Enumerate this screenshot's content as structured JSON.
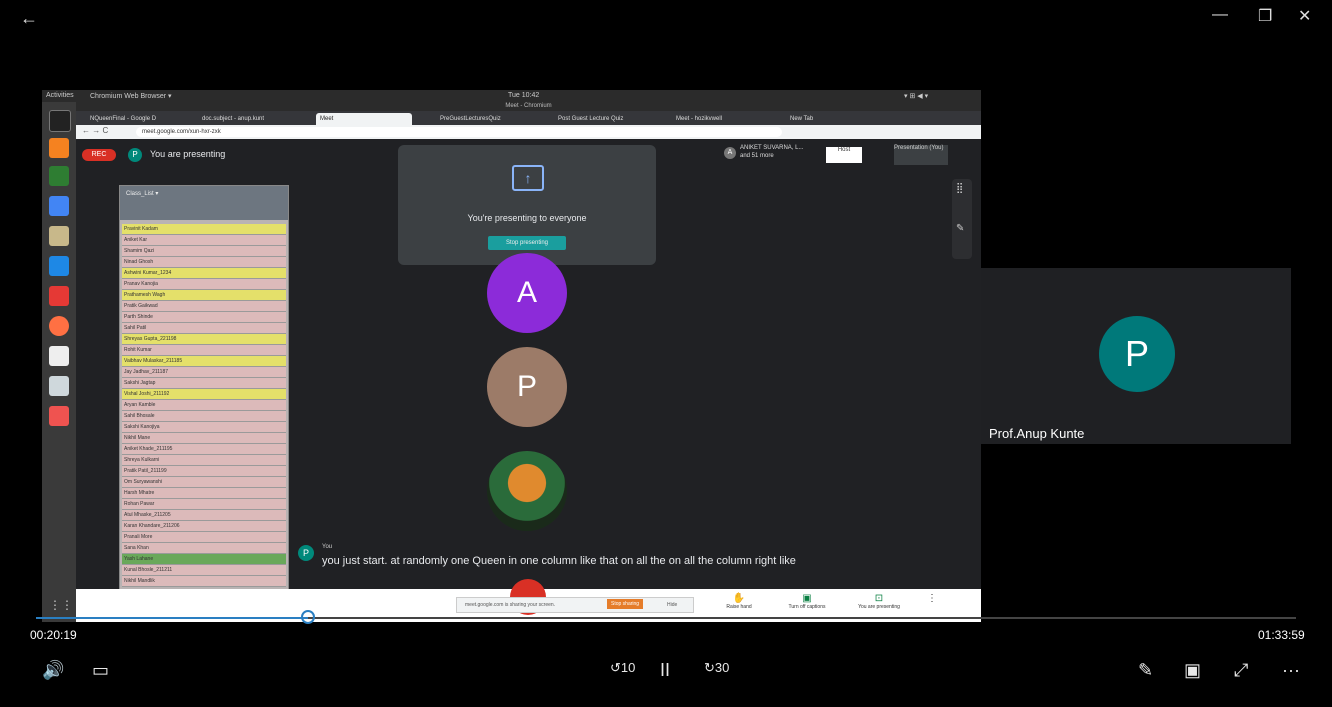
{
  "player": {
    "title_buttons": {
      "back": "←",
      "minimize": "—",
      "maximize": "❐",
      "close": "✕"
    },
    "time_current": "00:20:19",
    "time_total": "01:33:59",
    "progress_fraction": 0.216,
    "controls": {
      "volume": "🔊",
      "captions": "▭",
      "skip_back": "10",
      "pause": "II",
      "skip_forward": "30",
      "edit": "✎",
      "miniplayer": "▣",
      "fullscreen": "⤢",
      "more": "···"
    }
  },
  "desktop": {
    "activities": "Activities",
    "app_menu": "Chromium Web Browser ▾",
    "clock": "Tue 10:42",
    "tray": "▾ ⊞ ◀ ▾"
  },
  "browser": {
    "window_title": "Meet - Chromium",
    "tabs": [
      "NQueenFinal - Google D",
      "doc.subject - anup.kunt",
      "Meet",
      "PreGuestLecturesQuiz",
      "Post Guest Lecture Quiz",
      "Meet - hozikvwell",
      "New Tab"
    ],
    "url": "meet.google.com/xun-hxr-zxk"
  },
  "meet": {
    "rec_label": "REC",
    "you_initial": "P",
    "presenting_label": "You are presenting",
    "share_text": "You're presenting to everyone",
    "stop_label": "Stop presenting",
    "participants_line1": "ANIKET SUVARNA, L...",
    "participants_line2": "and 51 more",
    "participant_initial": "A",
    "host_label": "Host",
    "present_label": "Presentation (You)",
    "tiles": [
      {
        "initial": "A",
        "color": "#8c2bd9"
      },
      {
        "initial": "P",
        "color": "#9c7b68"
      }
    ],
    "caption_initial": "P",
    "caption_speaker": "You",
    "caption_text": "you just start. at randomly one Queen in one column like that on all the on all the column right like",
    "sharing_notice": "meet.google.com is sharing your screen.",
    "stop_sharing": "Stop sharing",
    "hide": "Hide",
    "controls": {
      "raise_hand": "Raise hand",
      "captions": "Turn off captions",
      "presenting": "You are presenting"
    }
  },
  "sheet": {
    "title": "Class_List ▾",
    "rows": [
      {
        "text": "Pravinit Kadam",
        "color": "yellow"
      },
      {
        "text": "Aniket Kar",
        "color": "pink"
      },
      {
        "text": "Shamim Qazi",
        "color": "pink"
      },
      {
        "text": "Ninad Ghosh",
        "color": "pink"
      },
      {
        "text": "Ashwini Kumar_1234",
        "color": "yellow"
      },
      {
        "text": "Pranav Kanojia",
        "color": "pink"
      },
      {
        "text": "Prathamesh Wagh",
        "color": "yellow"
      },
      {
        "text": "Pratik Gaikwad",
        "color": "pink"
      },
      {
        "text": "Parth Shinde",
        "color": "pink"
      },
      {
        "text": "Sahil Patil",
        "color": "pink"
      },
      {
        "text": "Shreyas Gupta_221198",
        "color": "yellow"
      },
      {
        "text": "Rohit Kumar",
        "color": "pink"
      },
      {
        "text": "Vaibhav Mulaskar_211185",
        "color": "yellow"
      },
      {
        "text": "Jay Jadhav_211187",
        "color": "pink"
      },
      {
        "text": "Sakshi Jagtap",
        "color": "pink"
      },
      {
        "text": "Vishal Joshi_211192",
        "color": "yellow"
      },
      {
        "text": "Aryan Kamble",
        "color": "pink"
      },
      {
        "text": "Sahil Bhosale",
        "color": "pink"
      },
      {
        "text": "Sakshi Kanojiya",
        "color": "pink"
      },
      {
        "text": "Nikhil Mane",
        "color": "pink"
      },
      {
        "text": "Aniket Khade_211195",
        "color": "pink"
      },
      {
        "text": "Shreya Kulkarni",
        "color": "pink"
      },
      {
        "text": "Pratik Patil_211199",
        "color": "pink"
      },
      {
        "text": "Om Suryawanshi",
        "color": "pink"
      },
      {
        "text": "Harsh Mhatre",
        "color": "pink"
      },
      {
        "text": "Rohan Pawar",
        "color": "pink"
      },
      {
        "text": "Atul Mhaske_211205",
        "color": "pink"
      },
      {
        "text": "Karan Khandare_211206",
        "color": "pink"
      },
      {
        "text": "Pranali More",
        "color": "pink"
      },
      {
        "text": "Sana Khan",
        "color": "pink"
      },
      {
        "text": "Yash Lahane",
        "color": "green"
      },
      {
        "text": "Kunal Bhosle_211211",
        "color": "pink"
      },
      {
        "text": "Nikhil Mandlik",
        "color": "pink"
      }
    ]
  },
  "side_tile": {
    "initial": "P",
    "name": "Prof.Anup Kunte"
  }
}
